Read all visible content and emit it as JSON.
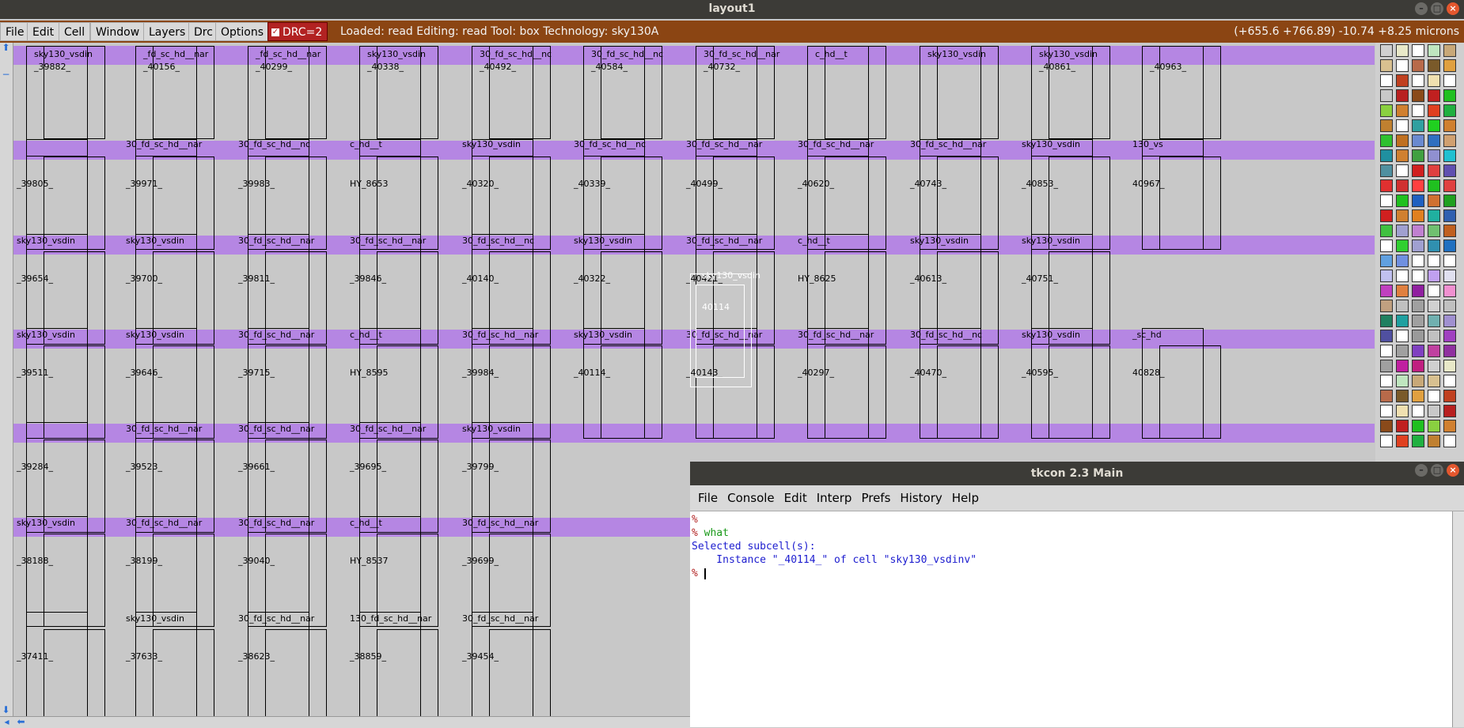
{
  "window": {
    "title": "layout1",
    "controls": [
      "–",
      "□",
      "×"
    ]
  },
  "menubar": {
    "items": [
      "File",
      "Edit",
      "Cell",
      "Window",
      "Layers",
      "Drc",
      "Options"
    ],
    "drc_label": "DRC=2",
    "status": "Loaded: read Editing: read Tool: box  Technology: sky130A",
    "coords": "(+655.6 +766.89) -10.74 +8.25 microns"
  },
  "layout": {
    "rows": [
      [
        "_39882_",
        "_40156_",
        "_40299_",
        "_40338_",
        "_40492_",
        "_40584_",
        "_40732_",
        "",
        "",
        "_40861_",
        "_40963_"
      ],
      [
        "_39805_",
        "_39971_",
        "_39983_",
        "HY_8653",
        "_40320_",
        "_40339_",
        "_40499_",
        "_40620_",
        "_40743_",
        "_40853_",
        "40967_"
      ],
      [
        "_39654_",
        "_39700_",
        "_39811_",
        "_39846_",
        "_40140_",
        "_40322_",
        "_40421_",
        "HY_8625",
        "_40613_",
        "_40751_"
      ],
      [
        "_39511_",
        "_39646_",
        "_39715_",
        "HY_8595",
        "_39984_",
        "_40114_",
        "_40143_",
        "_40297_",
        "_40470_",
        "_40595_",
        "40828_"
      ],
      [
        "_39284_",
        "_39523_",
        "_39661_",
        "_39695_",
        "_39799_"
      ],
      [
        "_38188_",
        "_38199_",
        "_39040_",
        "HY_8537",
        "_39699_"
      ],
      [
        "_37411_",
        "_37633_",
        "_38623_",
        "_38859_",
        "_39454_"
      ]
    ],
    "top_names": [
      "sky130_vsdin",
      "_fd_sc_hd__nar",
      "_fd_sc_hd__nar",
      "sky130_vsdin",
      "30_fd_sc_hd__nc",
      "30_fd_sc_hd__nc",
      "30_fd_sc_hd__nar",
      "c_hd__t",
      "sky130_vsdin",
      "sky130_vsdin"
    ],
    "cell_names": {
      "row1": [
        "",
        "30_fd_sc_hd__nar",
        "30_fd_sc_hd__nc",
        "c_hd__t",
        "sky130_vsdin",
        "30_fd_sc_hd__nc",
        "30_fd_sc_hd__nar",
        "30_fd_sc_hd__nar",
        "30_fd_sc_hd__nar",
        "sky130_vsdin",
        "130_vs"
      ],
      "row2": [
        "sky130_vsdin",
        "sky130_vsdin",
        "30_fd_sc_hd__nar",
        "30_fd_sc_hd__nar",
        "30_fd_sc_hd__nc",
        "sky130_vsdin",
        "30_fd_sc_hd__nar",
        "c_hd__t",
        "sky130_vsdin",
        "sky130_vsdin"
      ],
      "row3": [
        "sky130_vsdin",
        "sky130_vsdin",
        "30_fd_sc_hd__nar",
        "c_hd__t",
        "30_fd_sc_hd__nar",
        "sky130_vsdin",
        "30_fd_sc_hd__nar",
        "30_fd_sc_hd__nar",
        "30_fd_sc_hd__nc",
        "sky130_vsdin",
        "_sc_hd"
      ],
      "row4": [
        "",
        "30_fd_sc_hd__nar",
        "30_fd_sc_hd__nar",
        "30_fd_sc_hd__nar",
        "sky130_vsdin",
        "30_fd_sc_hd__nar",
        "30_fd_sc_hd__nar",
        "",
        "c_hd__t",
        "sky130_vsdin",
        "30_fd_sc_hd__nar"
      ],
      "row5": [
        "sky130_vsdin",
        "30_fd_sc_hd__nar",
        "30_fd_sc_hd__nar",
        "c_hd__t",
        "30_fd_sc_hd__nar"
      ],
      "row6": [
        "",
        "sky130_vsdin",
        "30_fd_sc_hd__nar",
        "130_fd_sc_hd__nar",
        "30_fd_sc_hd__nar"
      ]
    },
    "selected": {
      "name": "sky130_vsdin",
      "instance": "40114"
    }
  },
  "tkcon": {
    "title": "tkcon 2.3 Main",
    "menu": [
      "File",
      "Console",
      "Edit",
      "Interp",
      "Prefs",
      "History",
      "Help"
    ],
    "lines": [
      {
        "prompt": "%",
        "text": "",
        "kind": "cmd"
      },
      {
        "prompt": "%",
        "text": " what",
        "kind": "cmd"
      },
      {
        "prompt": "",
        "text": "Selected subcell(s):",
        "kind": "out"
      },
      {
        "prompt": "",
        "text": "    Instance \"_40114_\" of cell \"sky130_vsdinv\"",
        "kind": "out"
      },
      {
        "prompt": "%",
        "text": " ",
        "kind": "cmd"
      }
    ]
  },
  "colors": {
    "rail": "#b586e3",
    "background": "#c8c8c8",
    "menubar": "#8b4513",
    "drc": "#b22222"
  }
}
